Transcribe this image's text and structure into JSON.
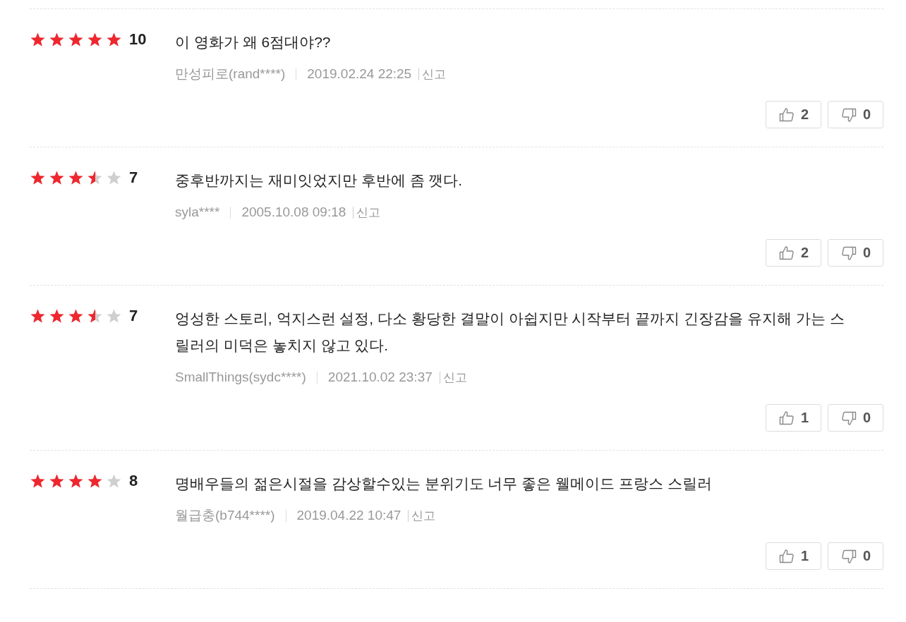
{
  "reviews": [
    {
      "stars": 5,
      "score": "10",
      "text": "이 영화가 왜 6점대야??",
      "author": "만성피로(rand****)",
      "date": "2019.02.24 22:25",
      "report": "신고",
      "likes": "2",
      "dislikes": "0"
    },
    {
      "stars": 3.5,
      "score": "7",
      "text": "중후반까지는 재미잇었지만 후반에 좀 깻다.",
      "author": "syla****",
      "date": "2005.10.08 09:18",
      "report": "신고",
      "likes": "2",
      "dislikes": "0"
    },
    {
      "stars": 3.5,
      "score": "7",
      "text": "엉성한 스토리, 억지스런 설정, 다소 황당한 결말이 아쉽지만 시작부터 끝까지 긴장감을 유지해 가는 스릴러의 미덕은 놓치지 않고 있다.",
      "author": "SmallThings(sydc****)",
      "date": "2021.10.02 23:37",
      "report": "신고",
      "likes": "1",
      "dislikes": "0"
    },
    {
      "stars": 4,
      "score": "8",
      "text": "명배우들의 젊은시절을 감상할수있는 분위기도 너무 좋은 웰메이드 프랑스 스릴러",
      "author": "월급충(b744****)",
      "date": "2019.04.22 10:47",
      "report": "신고",
      "likes": "1",
      "dislikes": "0"
    }
  ]
}
